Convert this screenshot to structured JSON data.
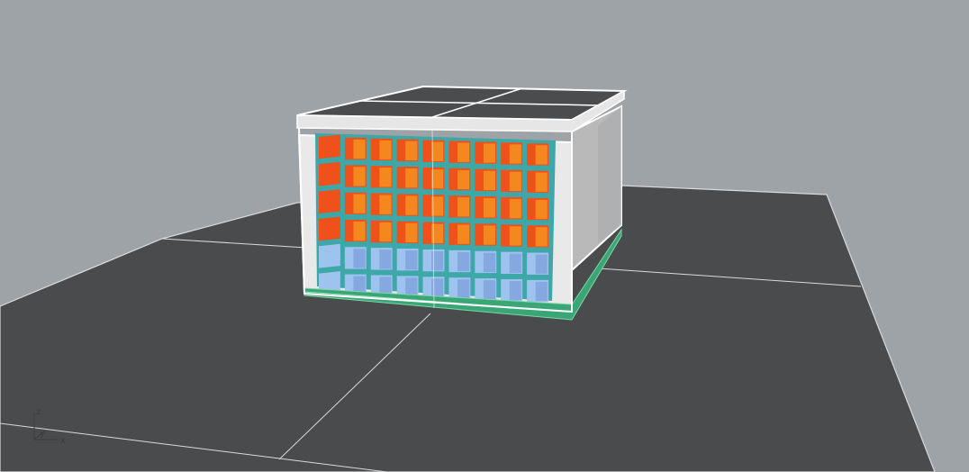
{
  "viewport": {
    "background_color": "#9ea3a8",
    "ground_color": "#4a4b4d",
    "grid_line_color": "#d8dadc"
  },
  "model": {
    "roof_color": "#4b4c4e",
    "frame_color": "#ffffff",
    "side_wall_color": "#b9b9ba",
    "backing_color": "#3ea7a8",
    "base_color": "#3aa676",
    "hot_tile_color": "#f0501a",
    "hot_tile_highlight": "#f59a20",
    "cool_tile_color": "#9ec3ef",
    "cool_tile_shadow": "#7391d6",
    "hot_rows": 4,
    "cool_rows": 2,
    "columns": 9
  },
  "axis_widget": {
    "x_label": "x",
    "y_label": "y",
    "z_label": "z",
    "icon": "axis-triad-icon"
  }
}
